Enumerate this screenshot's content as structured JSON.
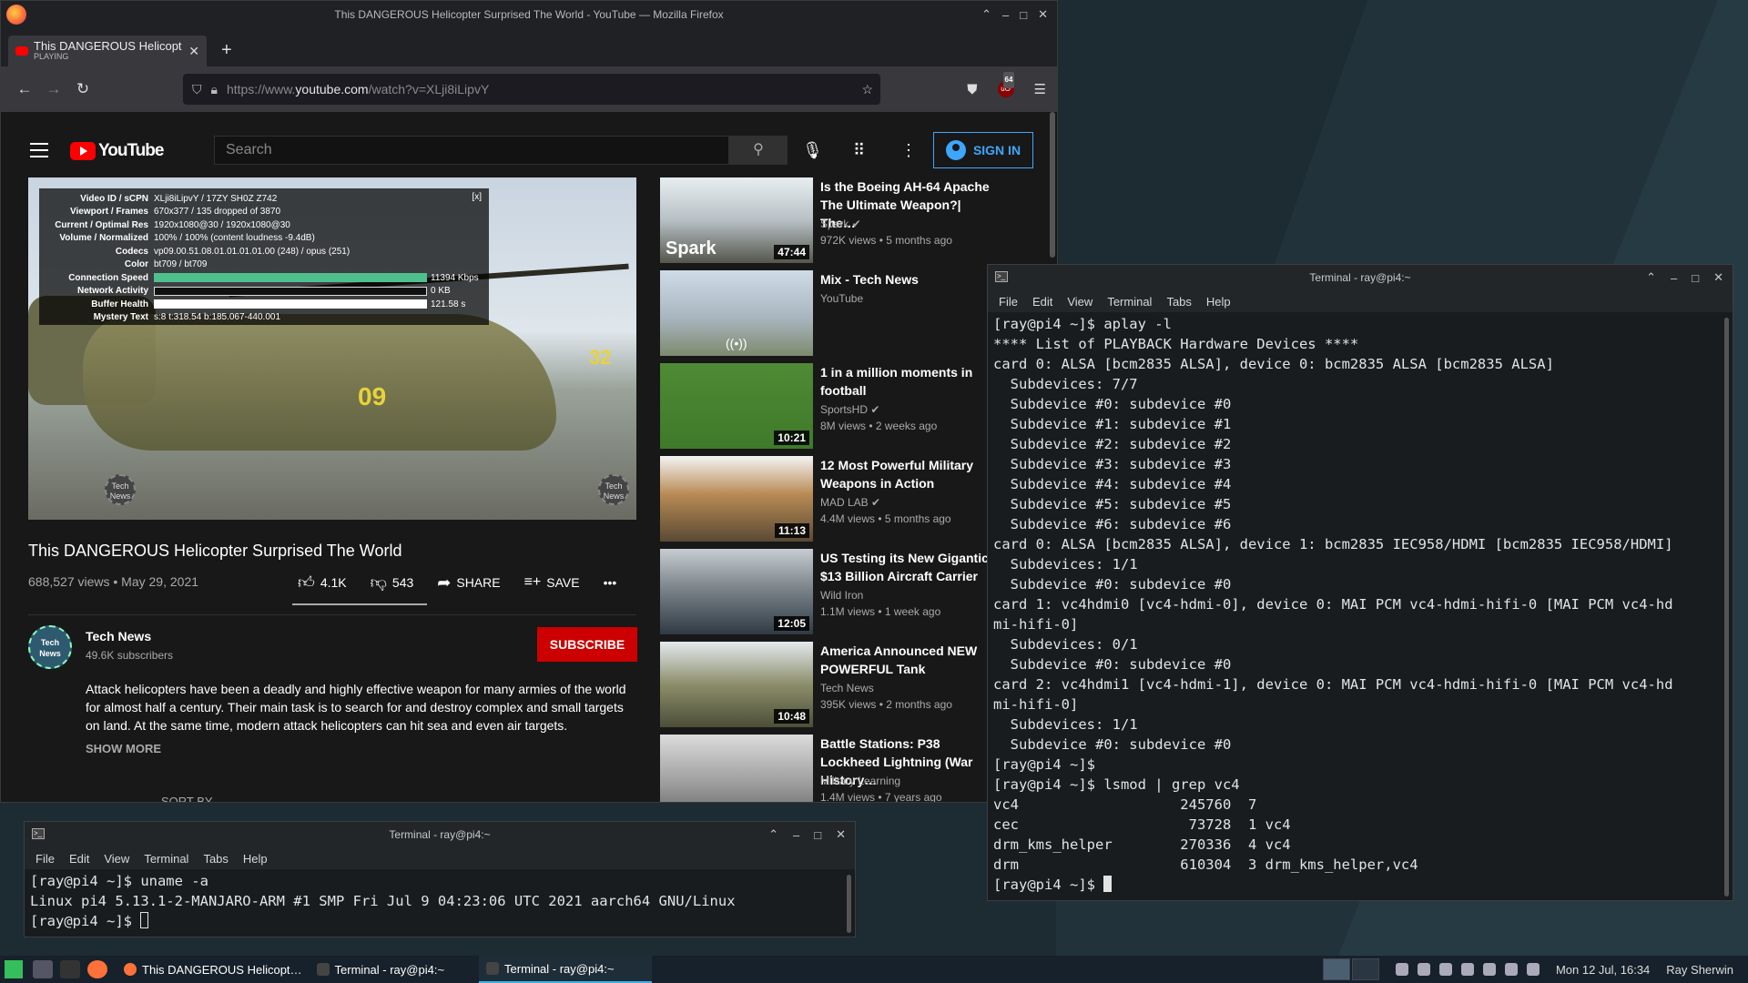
{
  "firefox": {
    "window_title": "This DANGEROUS Helicopter Surprised The World - YouTube — Mozilla Firefox",
    "window_controls": [
      "⌃",
      "–",
      "□",
      "✕"
    ],
    "tab": {
      "title": "This DANGEROUS Helicopt",
      "subtitle": "PLAYING",
      "close": "✕"
    },
    "new_tab": "+",
    "url": {
      "scheme": "https://www.",
      "host": "youtube.com",
      "path": "/watch?v=XLji8iLipvY"
    },
    "ublock_count": "64"
  },
  "youtube": {
    "logo_text": "YouTube",
    "search_placeholder": "Search",
    "sign_in": "SIGN IN",
    "stats": {
      "close": "[x]",
      "rows": [
        {
          "k": "Video ID / sCPN",
          "v": "XLji8iLipvY / 17ZY SH0Z Z742"
        },
        {
          "k": "Viewport / Frames",
          "v": "670x377 / 135 dropped of 3870"
        },
        {
          "k": "Current / Optimal Res",
          "v": "1920x1080@30 / 1920x1080@30"
        },
        {
          "k": "Volume / Normalized",
          "v": "100% / 100% (content loudness -9.4dB)"
        },
        {
          "k": "Codecs",
          "v": "vp09.00.51.08.01.01.01.01.00 (248) / opus (251)"
        },
        {
          "k": "Color",
          "v": "bt709 / bt709"
        }
      ],
      "bars": [
        {
          "k": "Connection Speed",
          "v": "11394 Kbps"
        },
        {
          "k": "Network Activity",
          "v": "0 KB"
        },
        {
          "k": "Buffer Health",
          "v": "121.58 s"
        }
      ],
      "mystery": {
        "k": "Mystery Text",
        "v": "s:8 t:318.54 b:185.067-440.001"
      }
    },
    "player_overlay": {
      "num_main": "09",
      "num_side": "32",
      "watermark": "Tech News"
    },
    "video": {
      "title": "This DANGEROUS Helicopter Surprised The World",
      "meta": "688,527 views • May 29, 2021",
      "likes": "4.1K",
      "dislikes": "543",
      "share": "SHARE",
      "save": "SAVE",
      "more": "•••"
    },
    "channel": {
      "avatar_text": "Tech News",
      "name": "Tech News",
      "subs": "49.6K subscribers",
      "subscribe": "SUBSCRIBE",
      "description": "Attack helicopters have been a deadly and highly effective weapon for many armies of the world for almost half a century. Their main task is to search for and destroy complex and small targets on land. At the same time, modern attack helicopters can hit sea and even air targets.",
      "show_more": "SHOW MORE",
      "sort_by": "SORT BY"
    },
    "recommendations": [
      {
        "title": "Is the Boeing AH-64 Apache The Ultimate Weapon?| The…",
        "channel": "Spark ✔",
        "meta": "972K views • 5 months ago",
        "duration": "47:44",
        "overlay": "Spark"
      },
      {
        "title": "Mix - Tech News",
        "channel": "YouTube",
        "meta": "",
        "duration": "",
        "overlay": "((•))"
      },
      {
        "title": "1 in a million moments in football",
        "channel": "SportsHD ✔",
        "meta": "8M views • 2 weeks ago",
        "duration": "10:21",
        "overlay": ""
      },
      {
        "title": "12 Most Powerful Military Weapons in Action",
        "channel": "MAD LAB ✔",
        "meta": "4.4M views • 5 months ago",
        "duration": "11:13",
        "overlay": ""
      },
      {
        "title": "US Testing its New Gigantic $13 Billion Aircraft Carrier",
        "channel": "Wild Iron",
        "meta": "1.1M views • 1 week ago",
        "duration": "12:05",
        "overlay": ""
      },
      {
        "title": "America Announced NEW POWERFUL Tank",
        "channel": "Tech News",
        "meta": "395K views • 2 months ago",
        "duration": "10:48",
        "overlay": ""
      },
      {
        "title": "Battle Stations: P38 Lockheed Lightning (War History…",
        "channel": "Military Learning",
        "meta": "1.4M views • 7 years ago",
        "duration": "",
        "overlay": ""
      }
    ]
  },
  "terminal_right": {
    "title": "Terminal - ray@pi4:~",
    "controls": [
      "⌃",
      "–",
      "□",
      "✕"
    ],
    "menu": [
      "File",
      "Edit",
      "View",
      "Terminal",
      "Tabs",
      "Help"
    ],
    "lines": [
      "[ray@pi4 ~]$ aplay -l",
      "**** List of PLAYBACK Hardware Devices ****",
      "card 0: ALSA [bcm2835 ALSA], device 0: bcm2835 ALSA [bcm2835 ALSA]",
      "  Subdevices: 7/7",
      "  Subdevice #0: subdevice #0",
      "  Subdevice #1: subdevice #1",
      "  Subdevice #2: subdevice #2",
      "  Subdevice #3: subdevice #3",
      "  Subdevice #4: subdevice #4",
      "  Subdevice #5: subdevice #5",
      "  Subdevice #6: subdevice #6",
      "card 0: ALSA [bcm2835 ALSA], device 1: bcm2835 IEC958/HDMI [bcm2835 IEC958/HDMI]",
      "  Subdevices: 1/1",
      "  Subdevice #0: subdevice #0",
      "card 1: vc4hdmi0 [vc4-hdmi-0], device 0: MAI PCM vc4-hdmi-hifi-0 [MAI PCM vc4-hd",
      "mi-hifi-0]",
      "  Subdevices: 0/1",
      "  Subdevice #0: subdevice #0",
      "card 2: vc4hdmi1 [vc4-hdmi-1], device 0: MAI PCM vc4-hdmi-hifi-0 [MAI PCM vc4-hd",
      "mi-hifi-0]",
      "  Subdevices: 1/1",
      "  Subdevice #0: subdevice #0",
      "[ray@pi4 ~]$",
      "[ray@pi4 ~]$ lsmod | grep vc4",
      "vc4                   245760  7",
      "cec                    73728  1 vc4",
      "drm_kms_helper        270336  4 vc4",
      "drm                   610304  3 drm_kms_helper,vc4"
    ],
    "prompt": "[ray@pi4 ~]$ "
  },
  "terminal_bottom": {
    "title": "Terminal - ray@pi4:~",
    "controls": [
      "⌃",
      "–",
      "□",
      "✕"
    ],
    "menu": [
      "File",
      "Edit",
      "View",
      "Terminal",
      "Tabs",
      "Help"
    ],
    "lines": [
      "[ray@pi4 ~]$ uname -a",
      "Linux pi4 5.13.1-2-MANJARO-ARM #1 SMP Fri Jul 9 04:23:06 UTC 2021 aarch64 GNU/Linux"
    ],
    "prompt": "[ray@pi4 ~]$ "
  },
  "taskbar": {
    "tasks": [
      {
        "label": "This DANGEROUS Helicopt…",
        "active": false
      },
      {
        "label": "Terminal - ray@pi4:~",
        "active": false
      },
      {
        "label": "Terminal - ray@pi4:~",
        "active": true
      }
    ],
    "clock": "Mon 12 Jul, 16:34",
    "user": "Ray Sherwin"
  }
}
